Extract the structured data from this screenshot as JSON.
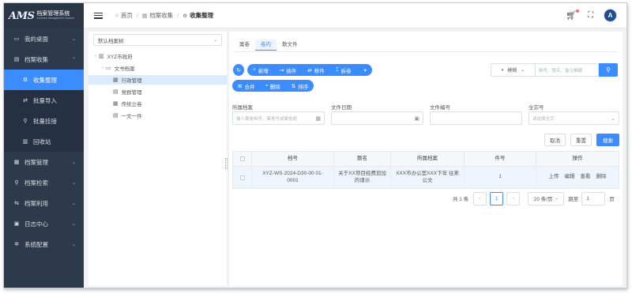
{
  "sidebar": {
    "logo_mark": "AMS",
    "logo_title": "档案管理系统",
    "logo_subtitle": "Archives Management System",
    "items": [
      {
        "label": "我的桌面",
        "icon": "monitor-icon"
      },
      {
        "label": "档案收集",
        "icon": "archive-icon"
      },
      {
        "label": "收集整理",
        "icon": "gear-icon"
      },
      {
        "label": "批量导入",
        "icon": "import-icon"
      },
      {
        "label": "批量挂接",
        "icon": "link-icon"
      },
      {
        "label": "回收站",
        "icon": "trash-icon"
      },
      {
        "label": "档案管理",
        "icon": "books-icon"
      },
      {
        "label": "档案检索",
        "icon": "search-icon"
      },
      {
        "label": "档案利用",
        "icon": "share-icon"
      },
      {
        "label": "日志中心",
        "icon": "log-icon"
      },
      {
        "label": "系统配置",
        "icon": "settings-icon"
      }
    ]
  },
  "header": {
    "breadcrumbs": [
      "首页",
      "档案收集",
      "收集整理"
    ]
  },
  "tree": {
    "selector": "默认档案树",
    "nodes": [
      {
        "label": "XYZ市政府",
        "icon": "building-icon",
        "toggle": "−"
      },
      {
        "label": "文书档案",
        "icon": "folder-icon",
        "toggle": "−"
      },
      {
        "label": "行政管理",
        "icon": "grid-icon"
      },
      {
        "label": "党群管理",
        "icon": "document-icon"
      },
      {
        "label": "传统立卷",
        "icon": "grid-icon"
      },
      {
        "label": "一文一件",
        "icon": "document-icon"
      }
    ]
  },
  "main": {
    "tabs": [
      "案卷",
      "卷内",
      "散文件"
    ],
    "active_tab": 1,
    "toolbar_row1": [
      "新增",
      "插件",
      "移件",
      "拆卷"
    ],
    "toolbar_row2": [
      "合并",
      "删除",
      "排序"
    ],
    "search_mode": "模糊",
    "search_placeholder": "档号、题名、备注模糊",
    "filters": {
      "archive_label": "所属档案",
      "archive_placeholder": "输入案卷档号、案卷号或案卷题",
      "date_label": "文件日期",
      "number_label": "文件编号",
      "fonds_label": "全宗号",
      "fonds_placeholder": "请选择全宗"
    },
    "actions": {
      "cancel": "取消",
      "reset": "重置",
      "search": "搜索"
    },
    "table": {
      "headers": [
        "档号",
        "题名",
        "所属档案",
        "件号",
        "操作"
      ],
      "rows": [
        {
          "code": "XYZ-WS·2024-D30-00 01-0001",
          "title": "关于XX项目经费追加 的请示",
          "archive": "XXX市办公室XXX下年 往来公文",
          "item_no": "1",
          "ops": [
            "上传",
            "编辑",
            "查看",
            "删除"
          ]
        }
      ]
    },
    "pagination": {
      "total": "共 1 条",
      "current": "1",
      "page_size": "20 条/页",
      "goto_label": "跳至",
      "goto_value": "1",
      "page_unit": "页"
    }
  }
}
